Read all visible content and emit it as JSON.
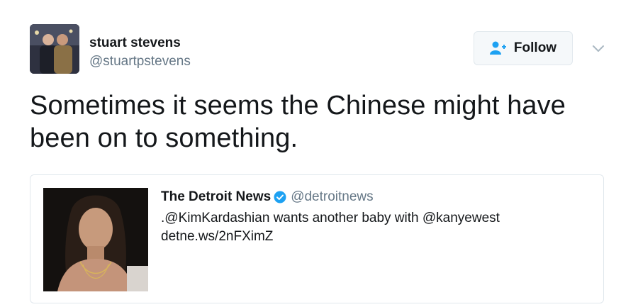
{
  "author": {
    "display_name": "stuart stevens",
    "handle": "@stuartpstevens"
  },
  "follow_button": {
    "label": "Follow",
    "icon": "add-user-icon"
  },
  "menu": {
    "icon": "chevron-down-icon"
  },
  "tweet": {
    "text": "Sometimes it seems the Chinese might have been on to something."
  },
  "quoted_tweet": {
    "display_name": "The Detroit News",
    "verified_icon": "verified-badge-icon",
    "handle": "@detroitnews",
    "text": ".@KimKardashian wants another baby with @kanyewest",
    "link": "detne.ws/2nFXimZ"
  },
  "colors": {
    "text": "#14171a",
    "secondary": "#657786",
    "accent": "#1da1f2",
    "border": "#e1e8ed"
  }
}
